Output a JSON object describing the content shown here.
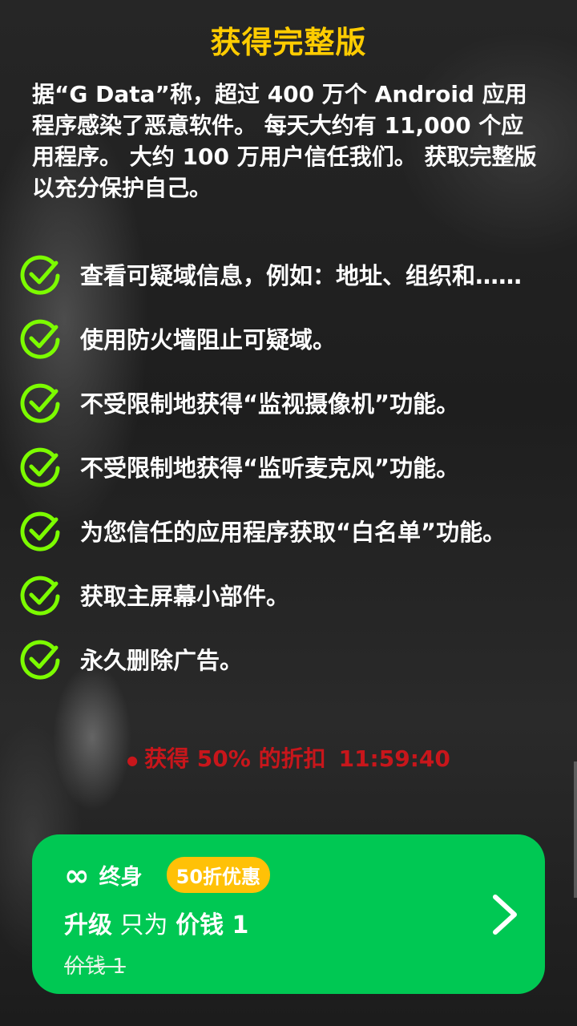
{
  "header": {
    "title": "获得完整版"
  },
  "intro": {
    "text": "据“G Data”称，超过 400 万个 Android 应用程序感染了恶意软件。 每天大约有 11,000 个应用程序。 大约 100 万用户信任我们。 获取完整版以充分保护自己。"
  },
  "features": [
    "查看可疑域信息，例如：地址、组织和……",
    "使用防火墙阻止可疑域。",
    "不受限制地获得“监视摄像机”功能。",
    "不受限制地获得“监听麦克风”功能。",
    "为您信任的应用程序获取“白名单”功能。",
    "获取主屏幕小部件。",
    "永久删除广告。"
  ],
  "discount": {
    "dot": "●",
    "label": "获得 50% 的折扣",
    "countdown": "11:59:40"
  },
  "offer": {
    "infinity": "∞",
    "plan": "终身",
    "badge": "50折优惠",
    "upgrade": "升级",
    "only_for": "只为",
    "price": "价钱 1",
    "old_price": "价钱 1"
  },
  "colors": {
    "accent_yellow": "#ffcc00",
    "check_green": "#7cfc00",
    "card_green": "#00c853",
    "badge_yellow": "#ffc107",
    "timer_red": "#c8161b"
  },
  "icons": {
    "check": "check-circle-icon",
    "chevron": "chevron-right-icon",
    "infinity": "infinity-icon"
  }
}
